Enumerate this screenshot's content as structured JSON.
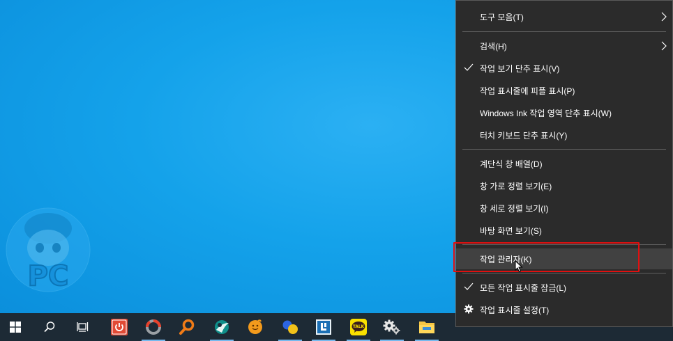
{
  "context_menu": {
    "items": [
      {
        "label": "도구 모음(T)",
        "checked": false,
        "submenu": true
      },
      {
        "label": "검색(H)",
        "checked": false,
        "submenu": true
      },
      {
        "label": "작업 보기 단추 표시(V)",
        "checked": true,
        "submenu": false
      },
      {
        "label": "작업 표시줄에 피플 표시(P)",
        "checked": false,
        "submenu": false
      },
      {
        "label": "Windows Ink 작업 영역 단추 표시(W)",
        "checked": false,
        "submenu": false
      },
      {
        "label": "터치 키보드 단추 표시(Y)",
        "checked": false,
        "submenu": false
      },
      {
        "label": "계단식 창 배열(D)",
        "checked": false,
        "submenu": false
      },
      {
        "label": "창 가로 정렬 보기(E)",
        "checked": false,
        "submenu": false
      },
      {
        "label": "창 세로 정렬 보기(I)",
        "checked": false,
        "submenu": false
      },
      {
        "label": "바탕 화면 보기(S)",
        "checked": false,
        "submenu": false
      },
      {
        "label": "작업 관리자(K)",
        "checked": false,
        "submenu": false,
        "highlighted": true
      },
      {
        "label": "모든 작업 표시줄 잠금(L)",
        "checked": true,
        "submenu": false
      },
      {
        "label": "작업 표시줄 설정(T)",
        "checked": false,
        "submenu": false,
        "icon": "gear-icon"
      }
    ]
  },
  "watermark": {
    "text": "PC"
  },
  "taskbar": {
    "items": [
      {
        "name": "start-button",
        "icon": "windows-logo-icon",
        "running": false
      },
      {
        "name": "search-button",
        "icon": "search-icon",
        "running": false
      },
      {
        "name": "task-view-button",
        "icon": "task-view-icon",
        "running": false
      },
      {
        "name": "app-red-power",
        "icon": "power-app-icon",
        "running": false
      },
      {
        "name": "app-ring",
        "icon": "ring-app-icon",
        "running": true
      },
      {
        "name": "app-magnifier",
        "icon": "magnifier-app-icon",
        "running": false
      },
      {
        "name": "app-teal-sphere",
        "icon": "teal-sphere-app-icon",
        "running": true
      },
      {
        "name": "app-orange-chat",
        "icon": "orange-chat-app-icon",
        "running": false
      },
      {
        "name": "app-bubbles",
        "icon": "bubbles-app-icon",
        "running": true
      },
      {
        "name": "app-l-box",
        "icon": "l-box-app-icon",
        "running": true
      },
      {
        "name": "app-kakaotalk",
        "icon": "kakaotalk-icon",
        "label": "TALK",
        "running": true
      },
      {
        "name": "app-settings",
        "icon": "settings-gear-icon",
        "running": true
      },
      {
        "name": "app-file-explorer",
        "icon": "folder-icon",
        "running": true
      }
    ]
  },
  "colors": {
    "accent_underline": "#76b9ed",
    "menu_bg": "#2b2b2b",
    "highlight_box": "#e01010",
    "taskbar_bg": "#1d2a35"
  }
}
